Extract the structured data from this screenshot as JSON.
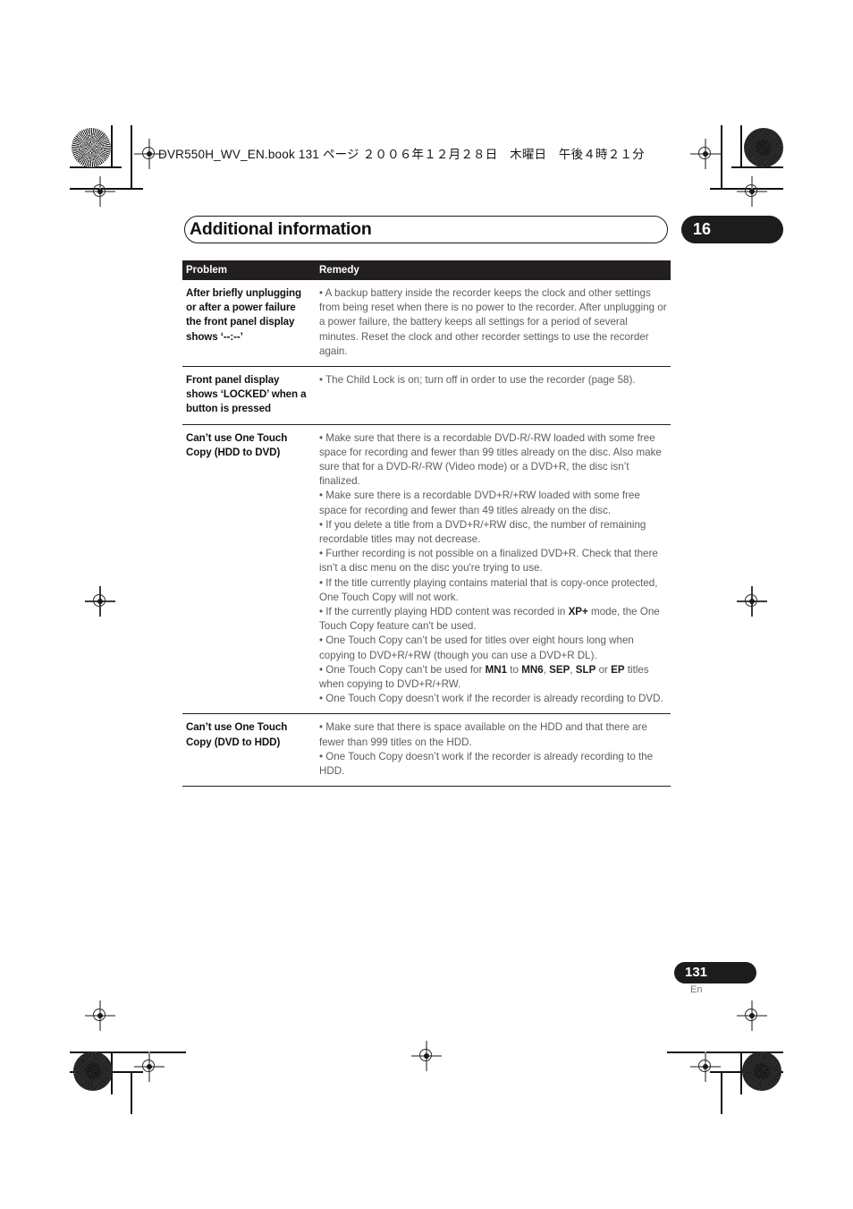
{
  "book_header": "DVR550H_WV_EN.book  131 ページ  ２００６年１２月２８日　木曜日　午後４時２１分",
  "chapter": {
    "title": "Additional information",
    "number": "16"
  },
  "table": {
    "headers": {
      "problem": "Problem",
      "remedy": "Remedy"
    },
    "rows": [
      {
        "problem": "After briefly unplugging or after a power failure the front panel display shows ‘--:--’",
        "remedy": [
          "• A backup battery inside the recorder keeps the clock and other settings from being reset when there is no power to the recorder. After unplugging or a power failure, the battery keeps all settings for a period of several minutes. Reset the clock and other recorder settings to use the recorder again."
        ]
      },
      {
        "problem": "Front panel display shows ‘LOCKED’ when a button is pressed",
        "remedy": [
          "• The Child Lock is on; turn off in order to use the recorder (page 58)."
        ]
      },
      {
        "problem": "Can’t use One Touch Copy (HDD to DVD)",
        "remedy": [
          "• Make sure that there is a recordable DVD-R/-RW loaded with some free space for recording and fewer than 99 titles already on the disc. Also make sure that for a DVD-R/-RW (Video mode) or a DVD+R, the disc isn’t finalized.",
          "• Make sure there is a recordable DVD+R/+RW loaded with some free space for recording and fewer than 49 titles already on the disc.",
          "• If you delete a title from a DVD+R/+RW disc, the number of remaining recordable titles may not decrease.",
          "• Further recording is not possible on a finalized DVD+R. Check that there isn’t a disc menu on the disc you're trying to use.",
          "• If the title currently playing contains material that is copy-once protected, One Touch Copy will not work.",
          "• If the currently playing HDD content was recorded in <b>XP+</b> mode, the One Touch Copy feature can't be used.",
          "• One Touch Copy can’t be used for titles over eight hours long when copying to DVD+R/+RW (though you can use a DVD+R DL).",
          "• One Touch Copy can’t be used for <b>MN1</b> to <b>MN6</b>, <b>SEP</b>, <b>SLP</b> or <b>EP</b> titles when copying to DVD+R/+RW.",
          "• One Touch Copy doesn’t work if the recorder is already recording to DVD."
        ]
      },
      {
        "problem": "Can’t use One Touch Copy (DVD to HDD)",
        "remedy": [
          "• Make sure that there is space available on the HDD and that there are fewer than 999 titles on the HDD.",
          "• One Touch Copy doesn’t work if the recorder is already recording to the HDD."
        ]
      }
    ]
  },
  "footer": {
    "page_number": "131",
    "language": "En"
  }
}
